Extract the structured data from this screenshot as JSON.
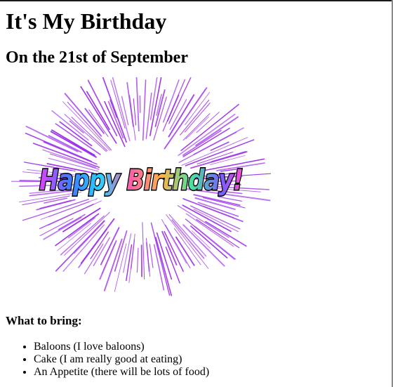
{
  "page": {
    "title": "It's My Birthday",
    "subtitle": "On the 21st of September"
  },
  "gif": {
    "caption_text": "Happy Birthday!",
    "icon": "birthday-fireworks-gif",
    "firework_color": "#9b30e8"
  },
  "bring": {
    "heading": "What to bring:",
    "items": [
      "Baloons (I love baloons)",
      "Cake (I am really good at eating)",
      "An Appetite (there will be lots of food)"
    ]
  }
}
